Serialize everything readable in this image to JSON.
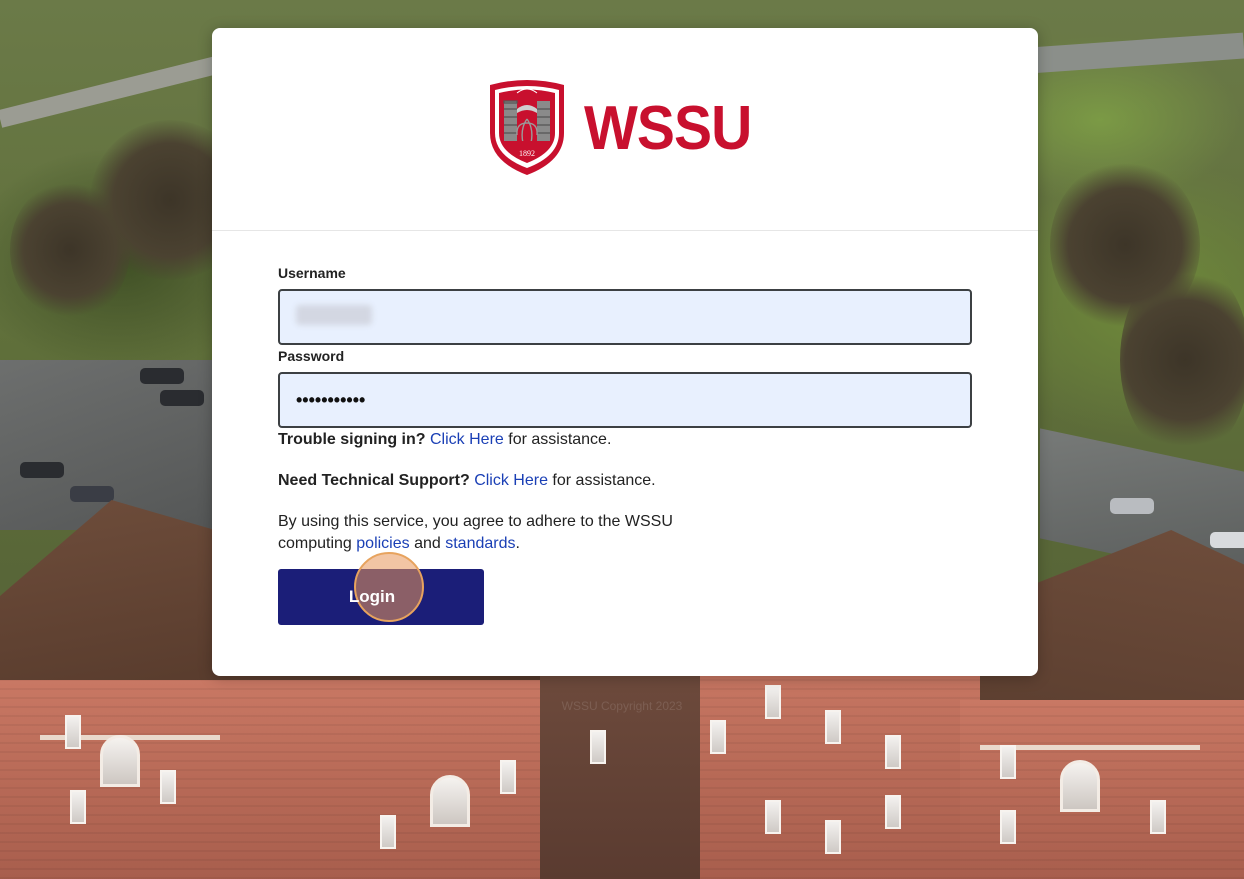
{
  "brand": {
    "wordmark": "WSSU",
    "seal_year": "1892",
    "primary_color": "#c8102e"
  },
  "form": {
    "username_label": "Username",
    "username_value": "",
    "password_label": "Password",
    "password_value": "•••••••••••"
  },
  "help": {
    "trouble_prefix": "Trouble signing in?",
    "trouble_link": "Click Here",
    "trouble_suffix": " for assistance.",
    "support_prefix": "Need Technical Support?",
    "support_link": "Click Here",
    "support_suffix": " for assistance.",
    "terms_text": "By using this service, you agree to adhere to the WSSU computing ",
    "policies_link": "policies",
    "and_text": " and ",
    "standards_link": "standards",
    "terms_end": "."
  },
  "login_button": {
    "label": "Login",
    "color": "#1b1e78"
  },
  "footer": {
    "copyright": "WSSU Copyright 2023"
  },
  "colors": {
    "link": "#1a3fb5",
    "input_bg": "#e8f0fe"
  }
}
